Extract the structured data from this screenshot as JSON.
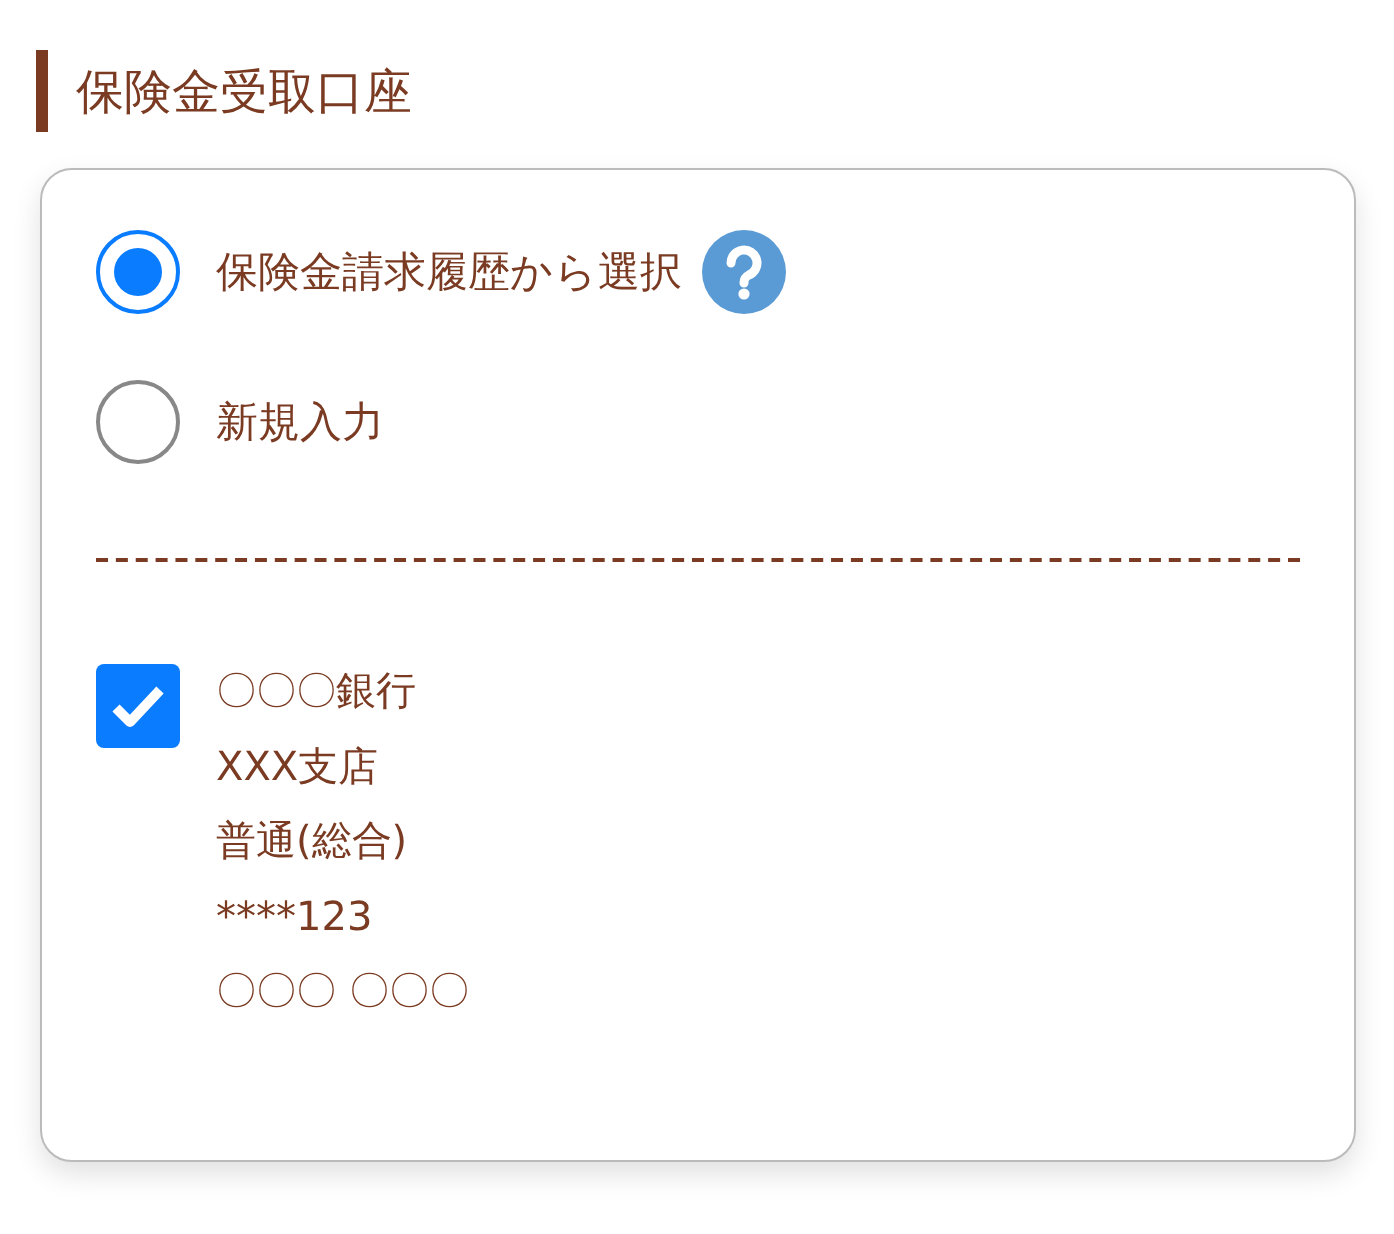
{
  "section": {
    "title": "保険金受取口座"
  },
  "options": [
    {
      "label": "保険金請求履歴から選択",
      "selected": true,
      "help": true
    },
    {
      "label": "新規入力",
      "selected": false,
      "help": false
    }
  ],
  "account": {
    "checked": true,
    "lines": [
      "〇〇〇銀行",
      "XXX支店",
      "普通(総合)",
      "****123",
      "〇〇〇 〇〇〇"
    ]
  }
}
